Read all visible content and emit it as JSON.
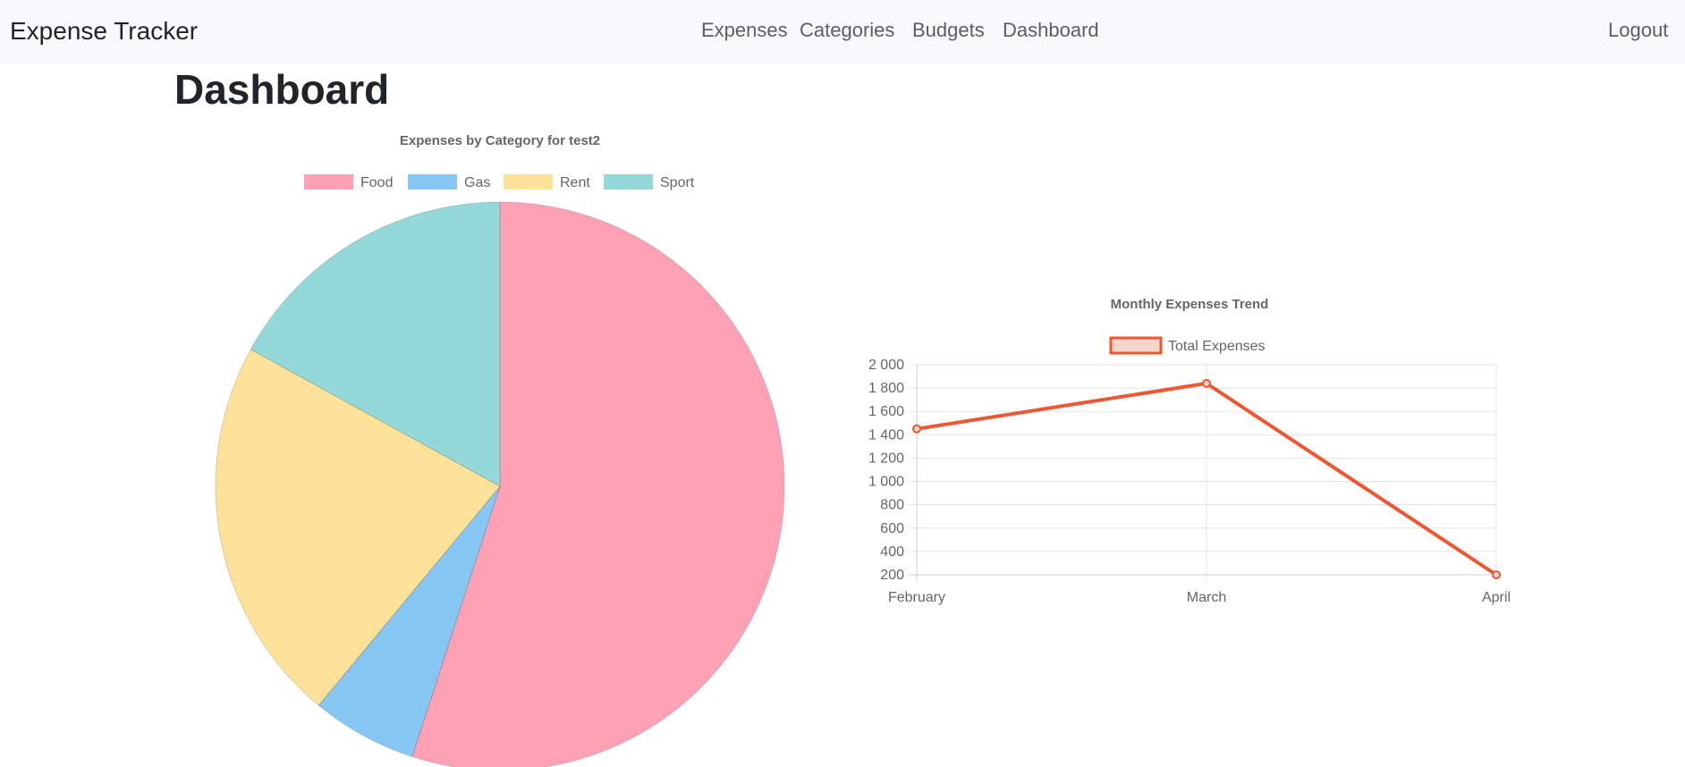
{
  "navbar": {
    "brand": "Expense Tracker",
    "links": [
      "Expenses",
      "Categories",
      "Budgets",
      "Dashboard"
    ],
    "logout": "Logout",
    "background": "#f8f9fa"
  },
  "page": {
    "title": "Dashboard"
  },
  "chart_data": [
    {
      "type": "pie",
      "title": "Expenses by Category for test2",
      "categories": [
        "Food",
        "Gas",
        "Rent",
        "Sport"
      ],
      "values": [
        55,
        6,
        22,
        17
      ],
      "colors": [
        "#ffa1b5",
        "#86c7f3",
        "#ffe29a",
        "#93d9d9"
      ],
      "legend_position": "top"
    },
    {
      "type": "line",
      "title": "Monthly Expenses Trend",
      "categories": [
        "February",
        "March",
        "April"
      ],
      "series": [
        {
          "name": "Total Expenses",
          "values": [
            1450,
            1840,
            200
          ],
          "color": "#f0562f"
        }
      ],
      "ylim": [
        200,
        2000
      ],
      "yticks": [
        "2 000",
        "1 800",
        "1 600",
        "1 400",
        "1 200",
        "1 000",
        "800",
        "600",
        "400",
        "200"
      ],
      "grid": true,
      "legend_position": "top"
    }
  ]
}
